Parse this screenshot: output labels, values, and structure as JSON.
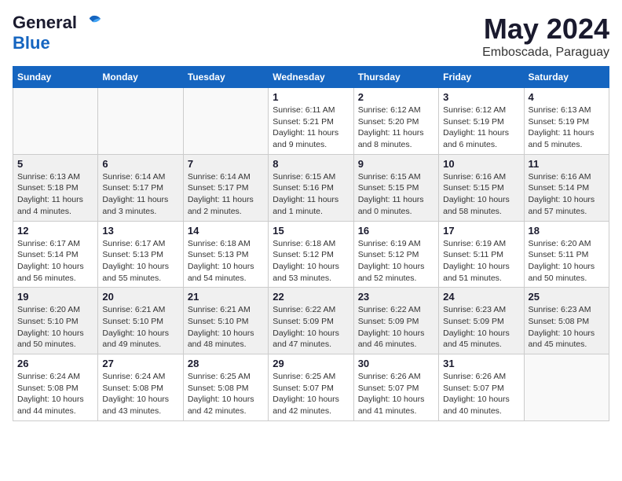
{
  "logo": {
    "general": "General",
    "blue": "Blue"
  },
  "title": "May 2024",
  "subtitle": "Emboscada, Paraguay",
  "weekdays": [
    "Sunday",
    "Monday",
    "Tuesday",
    "Wednesday",
    "Thursday",
    "Friday",
    "Saturday"
  ],
  "weeks": [
    [
      {
        "day": "",
        "info": ""
      },
      {
        "day": "",
        "info": ""
      },
      {
        "day": "",
        "info": ""
      },
      {
        "day": "1",
        "info": "Sunrise: 6:11 AM\nSunset: 5:21 PM\nDaylight: 11 hours\nand 9 minutes."
      },
      {
        "day": "2",
        "info": "Sunrise: 6:12 AM\nSunset: 5:20 PM\nDaylight: 11 hours\nand 8 minutes."
      },
      {
        "day": "3",
        "info": "Sunrise: 6:12 AM\nSunset: 5:19 PM\nDaylight: 11 hours\nand 6 minutes."
      },
      {
        "day": "4",
        "info": "Sunrise: 6:13 AM\nSunset: 5:19 PM\nDaylight: 11 hours\nand 5 minutes."
      }
    ],
    [
      {
        "day": "5",
        "info": "Sunrise: 6:13 AM\nSunset: 5:18 PM\nDaylight: 11 hours\nand 4 minutes."
      },
      {
        "day": "6",
        "info": "Sunrise: 6:14 AM\nSunset: 5:17 PM\nDaylight: 11 hours\nand 3 minutes."
      },
      {
        "day": "7",
        "info": "Sunrise: 6:14 AM\nSunset: 5:17 PM\nDaylight: 11 hours\nand 2 minutes."
      },
      {
        "day": "8",
        "info": "Sunrise: 6:15 AM\nSunset: 5:16 PM\nDaylight: 11 hours\nand 1 minute."
      },
      {
        "day": "9",
        "info": "Sunrise: 6:15 AM\nSunset: 5:15 PM\nDaylight: 11 hours\nand 0 minutes."
      },
      {
        "day": "10",
        "info": "Sunrise: 6:16 AM\nSunset: 5:15 PM\nDaylight: 10 hours\nand 58 minutes."
      },
      {
        "day": "11",
        "info": "Sunrise: 6:16 AM\nSunset: 5:14 PM\nDaylight: 10 hours\nand 57 minutes."
      }
    ],
    [
      {
        "day": "12",
        "info": "Sunrise: 6:17 AM\nSunset: 5:14 PM\nDaylight: 10 hours\nand 56 minutes."
      },
      {
        "day": "13",
        "info": "Sunrise: 6:17 AM\nSunset: 5:13 PM\nDaylight: 10 hours\nand 55 minutes."
      },
      {
        "day": "14",
        "info": "Sunrise: 6:18 AM\nSunset: 5:13 PM\nDaylight: 10 hours\nand 54 minutes."
      },
      {
        "day": "15",
        "info": "Sunrise: 6:18 AM\nSunset: 5:12 PM\nDaylight: 10 hours\nand 53 minutes."
      },
      {
        "day": "16",
        "info": "Sunrise: 6:19 AM\nSunset: 5:12 PM\nDaylight: 10 hours\nand 52 minutes."
      },
      {
        "day": "17",
        "info": "Sunrise: 6:19 AM\nSunset: 5:11 PM\nDaylight: 10 hours\nand 51 minutes."
      },
      {
        "day": "18",
        "info": "Sunrise: 6:20 AM\nSunset: 5:11 PM\nDaylight: 10 hours\nand 50 minutes."
      }
    ],
    [
      {
        "day": "19",
        "info": "Sunrise: 6:20 AM\nSunset: 5:10 PM\nDaylight: 10 hours\nand 50 minutes."
      },
      {
        "day": "20",
        "info": "Sunrise: 6:21 AM\nSunset: 5:10 PM\nDaylight: 10 hours\nand 49 minutes."
      },
      {
        "day": "21",
        "info": "Sunrise: 6:21 AM\nSunset: 5:10 PM\nDaylight: 10 hours\nand 48 minutes."
      },
      {
        "day": "22",
        "info": "Sunrise: 6:22 AM\nSunset: 5:09 PM\nDaylight: 10 hours\nand 47 minutes."
      },
      {
        "day": "23",
        "info": "Sunrise: 6:22 AM\nSunset: 5:09 PM\nDaylight: 10 hours\nand 46 minutes."
      },
      {
        "day": "24",
        "info": "Sunrise: 6:23 AM\nSunset: 5:09 PM\nDaylight: 10 hours\nand 45 minutes."
      },
      {
        "day": "25",
        "info": "Sunrise: 6:23 AM\nSunset: 5:08 PM\nDaylight: 10 hours\nand 45 minutes."
      }
    ],
    [
      {
        "day": "26",
        "info": "Sunrise: 6:24 AM\nSunset: 5:08 PM\nDaylight: 10 hours\nand 44 minutes."
      },
      {
        "day": "27",
        "info": "Sunrise: 6:24 AM\nSunset: 5:08 PM\nDaylight: 10 hours\nand 43 minutes."
      },
      {
        "day": "28",
        "info": "Sunrise: 6:25 AM\nSunset: 5:08 PM\nDaylight: 10 hours\nand 42 minutes."
      },
      {
        "day": "29",
        "info": "Sunrise: 6:25 AM\nSunset: 5:07 PM\nDaylight: 10 hours\nand 42 minutes."
      },
      {
        "day": "30",
        "info": "Sunrise: 6:26 AM\nSunset: 5:07 PM\nDaylight: 10 hours\nand 41 minutes."
      },
      {
        "day": "31",
        "info": "Sunrise: 6:26 AM\nSunset: 5:07 PM\nDaylight: 10 hours\nand 40 minutes."
      },
      {
        "day": "",
        "info": ""
      }
    ]
  ]
}
